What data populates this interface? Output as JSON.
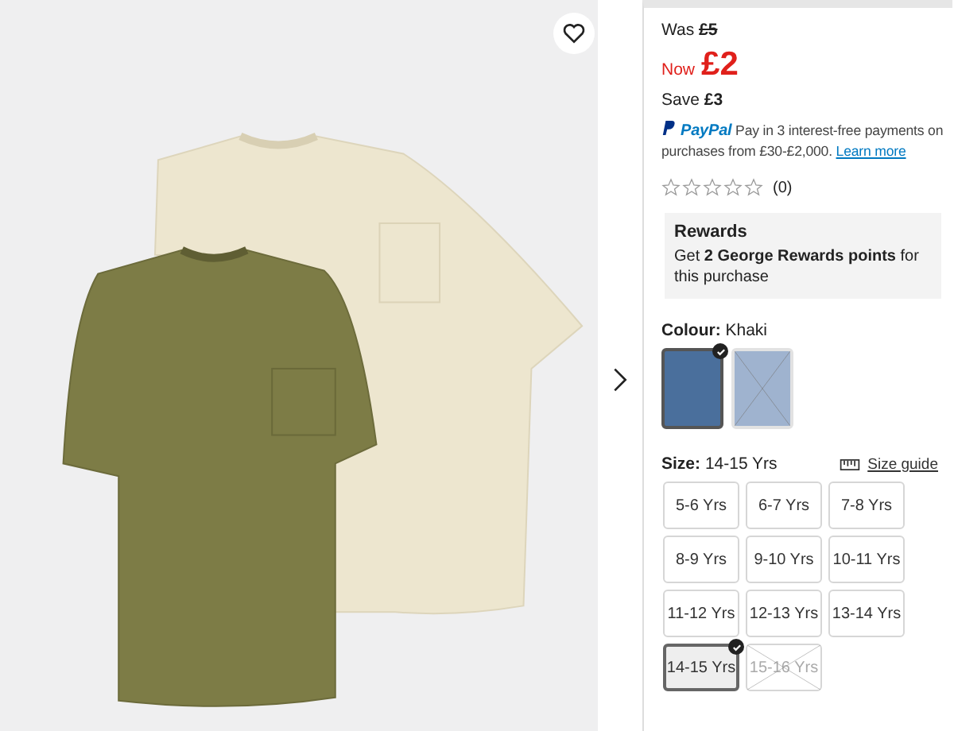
{
  "product_image": {
    "saved": false
  },
  "price": {
    "was_label": "Was",
    "was": "£5",
    "now_label": "Now",
    "now": "£2",
    "save_label": "Save",
    "save": "£3"
  },
  "paypal": {
    "brand": "PayPal",
    "text": "Pay in 3 interest-free payments on purchases from £30-£2,000.",
    "link": "Learn more"
  },
  "rating": {
    "stars": 0,
    "count": "(0)"
  },
  "rewards": {
    "title": "Rewards",
    "text": "Get **2 George Rewards points** for this purchase"
  },
  "colour": {
    "label": "Colour:",
    "value": "Khaki",
    "swatches": [
      {
        "selected": true,
        "available": true,
        "color": "#4a6f9c"
      },
      {
        "selected": false,
        "available": false,
        "color": "#9fb3cf"
      }
    ]
  },
  "size": {
    "label": "Size:",
    "value": "14-15 Yrs",
    "guide": "Size guide",
    "options": [
      {
        "label": "5-6 Yrs",
        "selected": false,
        "available": true
      },
      {
        "label": "6-7 Yrs",
        "selected": false,
        "available": true
      },
      {
        "label": "7-8 Yrs",
        "selected": false,
        "available": true
      },
      {
        "label": "8-9 Yrs",
        "selected": false,
        "available": true
      },
      {
        "label": "9-10 Yrs",
        "selected": false,
        "available": true
      },
      {
        "label": "10-11 Yrs",
        "selected": false,
        "available": true
      },
      {
        "label": "11-12 Yrs",
        "selected": false,
        "available": true
      },
      {
        "label": "12-13 Yrs",
        "selected": false,
        "available": true
      },
      {
        "label": "13-14 Yrs",
        "selected": false,
        "available": true
      },
      {
        "label": "14-15 Yrs",
        "selected": true,
        "available": true
      },
      {
        "label": "15-16 Yrs",
        "selected": false,
        "available": false
      }
    ]
  }
}
